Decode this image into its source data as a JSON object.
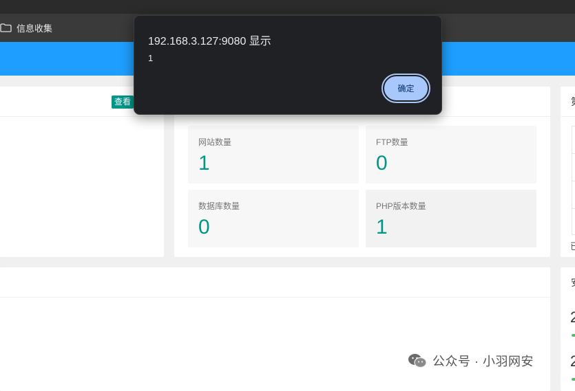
{
  "bookmarks": {
    "folder_label": "信息收集"
  },
  "dashboard": {
    "view_button": "查看",
    "stats": [
      {
        "label": "网站数量",
        "value": "1"
      },
      {
        "label": "FTP数量",
        "value": "0"
      },
      {
        "label": "数据库数量",
        "value": "0"
      },
      {
        "label": "PHP版本数量",
        "value": "1"
      }
    ],
    "right_panel": {
      "title_fragment": "第",
      "bottom_fragment": "已"
    },
    "security_panel": {
      "title_fragment": "安",
      "values": [
        "2",
        "2"
      ]
    }
  },
  "alert_dialog": {
    "title": "192.168.3.127:9080 显示",
    "message": "1",
    "ok_label": "确定"
  },
  "watermark": {
    "text": "公众号 · 小羽网安"
  },
  "colors": {
    "accent_blue": "#1e9fff",
    "teal": "#009688",
    "dialog_bg": "#202124",
    "button_blue": "#a8c7fa"
  }
}
